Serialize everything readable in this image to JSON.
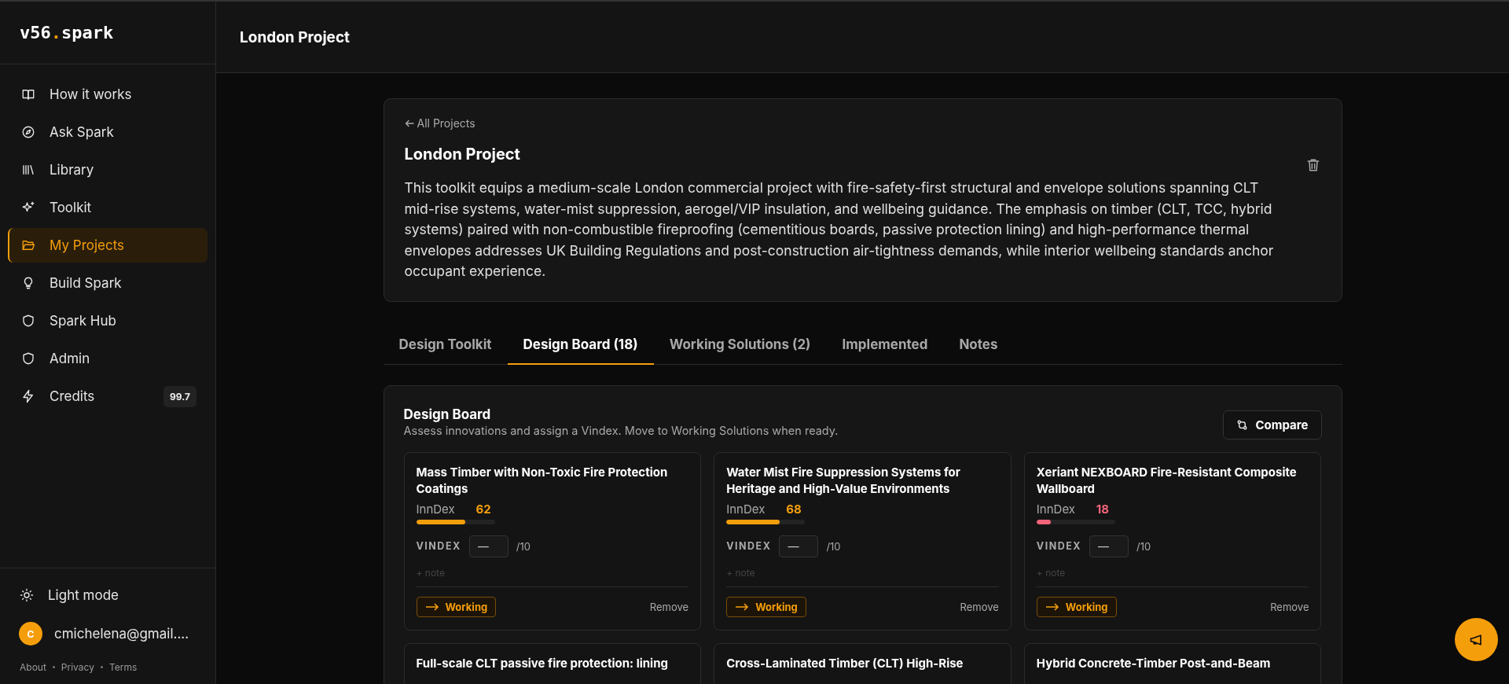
{
  "sidebar": {
    "logo": {
      "left": "v56",
      "dot": ".",
      "right": "spark"
    },
    "items": [
      {
        "label": "How it works",
        "selected": false
      },
      {
        "label": "Ask Spark",
        "selected": false
      },
      {
        "label": "Library",
        "selected": false
      },
      {
        "label": "Toolkit",
        "selected": false
      },
      {
        "label": "My Projects",
        "selected": true
      },
      {
        "label": "Build Spark",
        "selected": false
      },
      {
        "label": "Spark Hub",
        "selected": false
      },
      {
        "label": "Admin",
        "selected": false
      },
      {
        "label": "Credits",
        "selected": false,
        "badge": "99.7"
      }
    ],
    "theme_toggle": "Light mode",
    "user": {
      "initial": "C",
      "email": "cmichelena@gmail...."
    },
    "footer_links": [
      "About",
      "Privacy",
      "Terms"
    ]
  },
  "header": {
    "title": "London Project"
  },
  "project": {
    "back_link": "All Projects",
    "title": "London Project",
    "description": "This toolkit equips a medium-scale London commercial project with fire-safety-first structural and envelope solutions spanning CLT mid-rise systems, water-mist suppression, aerogel/VIP insulation, and wellbeing guidance. The emphasis on timber (CLT, TCC, hybrid systems) paired with non-combustible fireproofing (cementitious boards, passive protection lining) and high-performance thermal envelopes addresses UK Building Regulations and post-construction air-tightness demands, while interior wellbeing standards anchor occupant experience."
  },
  "tabs": [
    {
      "label": "Design Toolkit",
      "selected": false
    },
    {
      "label": "Design Board (18)",
      "selected": true
    },
    {
      "label": "Working Solutions (2)",
      "selected": false
    },
    {
      "label": "Implemented",
      "selected": false
    },
    {
      "label": "Notes",
      "selected": false
    }
  ],
  "board": {
    "title": "Design Board",
    "subtitle": "Assess innovations and assign a Vindex. Move to Working Solutions when ready.",
    "compare_button": "Compare",
    "cards": [
      {
        "title": "Mass Timber with Non-Toxic Fire Protection Coatings",
        "inndex_label": "InnDex",
        "inndex": "62",
        "level": 0.62,
        "color": "#f59e0b",
        "vindex_label": "VINDEX",
        "vindex_placeholder": "—",
        "vindex_max": "/10",
        "note": "+ note",
        "move_button": "Working",
        "remove": "Remove"
      },
      {
        "title": "Water Mist Fire Suppression Systems for Heritage and High-Value Environments",
        "inndex_label": "InnDex",
        "inndex": "68",
        "level": 0.68,
        "color": "#f59e0b",
        "vindex_label": "VINDEX",
        "vindex_placeholder": "—",
        "vindex_max": "/10",
        "note": "+ note",
        "move_button": "Working",
        "remove": "Remove"
      },
      {
        "title": "Xeriant NEXBOARD Fire-Resistant Composite Wallboard",
        "inndex_label": "InnDex",
        "inndex": "18",
        "level": 0.18,
        "color": "#f4647a",
        "vindex_label": "VINDEX",
        "vindex_placeholder": "—",
        "vindex_max": "/10",
        "note": "+ note",
        "move_button": "Working",
        "remove": "Remove"
      },
      {
        "title": "Full-scale CLT passive fire protection: lining"
      },
      {
        "title": "Cross-Laminated Timber (CLT) High-Rise"
      },
      {
        "title": "Hybrid Concrete-Timber Post-and-Beam"
      }
    ]
  }
}
